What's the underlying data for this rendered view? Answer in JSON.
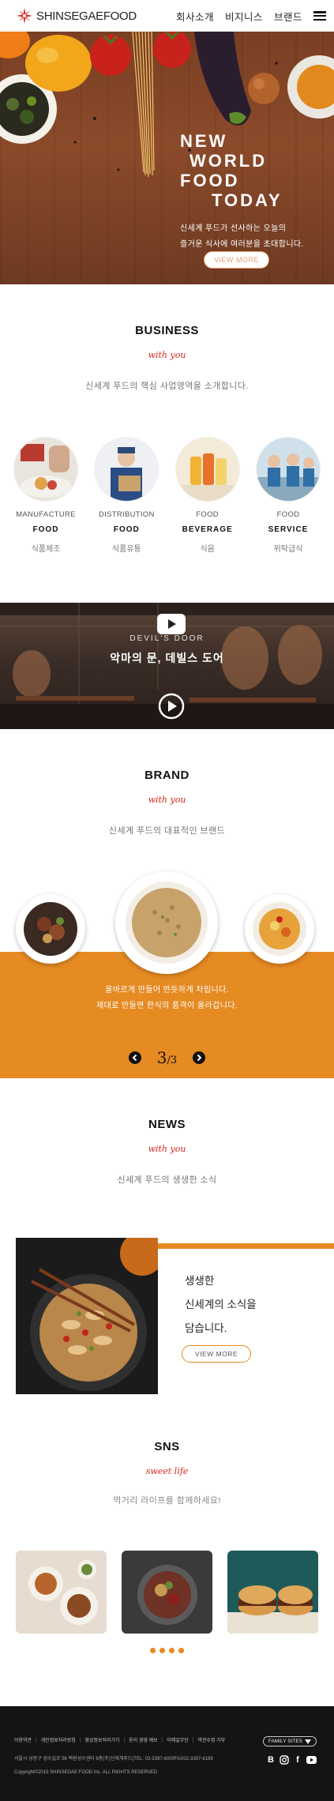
{
  "header": {
    "logo_text": "SHINSEGAEFOOD",
    "nav": [
      "회사소개",
      "비지니스",
      "브랜드"
    ]
  },
  "hero": {
    "title_lines": [
      "NEW",
      "WORLD",
      "FOOD",
      "TODAY"
    ],
    "sub_lines": [
      "신세계 푸드가 선사하는 오늘의",
      "즐거운 식사에 여러분을 초대합니다."
    ],
    "button": "VIEW MORE"
  },
  "business": {
    "title": "BUSINESS",
    "script": "with you",
    "desc": "신세계 푸드의 핵심 사업영역을 소개합니다.",
    "items": [
      {
        "en1": "MANUFACTURE",
        "en2": "FOOD",
        "ko": "식품제조"
      },
      {
        "en1": "DISTRIBUTION",
        "en2": "FOOD",
        "ko": "식품유통"
      },
      {
        "en1": "FOOD",
        "en2": "BEVERAGE",
        "ko": "식음"
      },
      {
        "en1": "FOOD",
        "en2": "SERVICE",
        "ko": "위탁급식"
      }
    ]
  },
  "video": {
    "tag": "DEVIL'S DOOR",
    "title": "악마의 문, 데빌스 도어"
  },
  "brand": {
    "title": "BRAND",
    "script": "with you",
    "desc": "신세계 푸드의 대표적인 브랜드",
    "copy_lines": [
      "올바르게 만들어 반듯하게 차립니다.",
      "제대로 만들면 한식의 품격이 올라갑니다."
    ],
    "page_current": "3",
    "page_total": "3"
  },
  "news": {
    "title": "NEWS",
    "script": "with you",
    "desc": "신세계 푸드의 생생한 소식",
    "copy_lines": [
      "생생한",
      "신세계의 소식을",
      "담습니다."
    ],
    "button": "VIEW MORE"
  },
  "sns": {
    "title": "SNS",
    "script": "sweet life",
    "desc": "먹거리 라이프를 함께하세요!"
  },
  "footer": {
    "links": [
      "이용약관",
      "개인정보처리방침",
      "영상정보처리기기",
      "윤리 경영 제보",
      "이메일무단",
      "약관수정 가부"
    ],
    "address": "서울시 성동구 성수일로 56 백원성수센터 6층(주)신세계푸드(TEL: 02-3397-6000FAX02-3397-6199",
    "copyright": "Copyright©2015 SHINSEGAE FOOD Inc. ALL RIGHTS RESERVED",
    "family_label": "FAMILY SITES",
    "social_icons": [
      "blog-icon",
      "instagram-icon",
      "facebook-icon",
      "youtube-icon"
    ]
  },
  "colors": {
    "accent": "#e68a22",
    "script_red": "#d9281e",
    "footer_bg": "#141414"
  }
}
